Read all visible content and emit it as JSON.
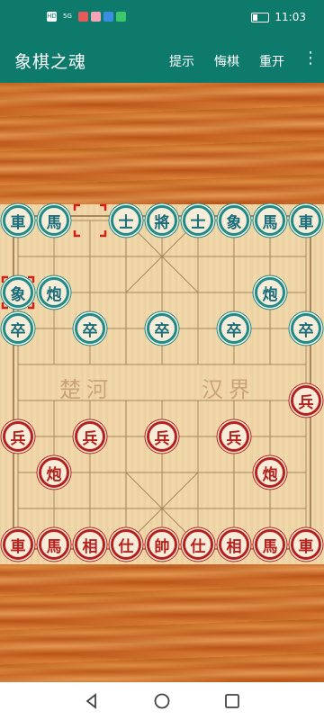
{
  "status_bar": {
    "time": "11:03",
    "left_icons": [
      "HD",
      "5G",
      "app-icon-red",
      "app-icon-pink",
      "app-icon-blue",
      "app-icon-green"
    ]
  },
  "app_bar": {
    "title": "象棋之魂",
    "hint": "提示",
    "undo": "悔棋",
    "restart": "重开",
    "menu_icon": "⋮"
  },
  "board": {
    "river_left": "楚河",
    "river_right": "汉界"
  },
  "pieces": [
    {
      "side": "black",
      "char": "車",
      "col": 0,
      "row": 0
    },
    {
      "side": "black",
      "char": "馬",
      "col": 1,
      "row": 0
    },
    {
      "side": "black",
      "char": "士",
      "col": 3,
      "row": 0
    },
    {
      "side": "black",
      "char": "將",
      "col": 4,
      "row": 0
    },
    {
      "side": "black",
      "char": "士",
      "col": 5,
      "row": 0
    },
    {
      "side": "black",
      "char": "象",
      "col": 6,
      "row": 0
    },
    {
      "side": "black",
      "char": "馬",
      "col": 7,
      "row": 0
    },
    {
      "side": "black",
      "char": "車",
      "col": 8,
      "row": 0
    },
    {
      "side": "black",
      "char": "象",
      "col": 0,
      "row": 2
    },
    {
      "side": "black",
      "char": "炮",
      "col": 1,
      "row": 2
    },
    {
      "side": "black",
      "char": "炮",
      "col": 7,
      "row": 2
    },
    {
      "side": "black",
      "char": "卒",
      "col": 0,
      "row": 3
    },
    {
      "side": "black",
      "char": "卒",
      "col": 2,
      "row": 3
    },
    {
      "side": "black",
      "char": "卒",
      "col": 4,
      "row": 3
    },
    {
      "side": "black",
      "char": "卒",
      "col": 6,
      "row": 3
    },
    {
      "side": "black",
      "char": "卒",
      "col": 8,
      "row": 3
    },
    {
      "side": "red",
      "char": "兵",
      "col": 8,
      "row": 5
    },
    {
      "side": "red",
      "char": "兵",
      "col": 0,
      "row": 6
    },
    {
      "side": "red",
      "char": "兵",
      "col": 2,
      "row": 6
    },
    {
      "side": "red",
      "char": "兵",
      "col": 4,
      "row": 6
    },
    {
      "side": "red",
      "char": "兵",
      "col": 6,
      "row": 6
    },
    {
      "side": "red",
      "char": "炮",
      "col": 1,
      "row": 7
    },
    {
      "side": "red",
      "char": "炮",
      "col": 7,
      "row": 7
    },
    {
      "side": "red",
      "char": "車",
      "col": 0,
      "row": 9
    },
    {
      "side": "red",
      "char": "馬",
      "col": 1,
      "row": 9
    },
    {
      "side": "red",
      "char": "相",
      "col": 2,
      "row": 9
    },
    {
      "side": "red",
      "char": "仕",
      "col": 3,
      "row": 9
    },
    {
      "side": "red",
      "char": "帥",
      "col": 4,
      "row": 9
    },
    {
      "side": "red",
      "char": "仕",
      "col": 5,
      "row": 9
    },
    {
      "side": "red",
      "char": "相",
      "col": 6,
      "row": 9
    },
    {
      "side": "red",
      "char": "馬",
      "col": 7,
      "row": 9
    },
    {
      "side": "red",
      "char": "車",
      "col": 8,
      "row": 9
    }
  ],
  "last_move": {
    "from": {
      "col": 2,
      "row": 0
    },
    "to": {
      "col": 0,
      "row": 2
    }
  },
  "colors": {
    "app_bar": "#0e7a6b",
    "black_piece": "#1f8a8a",
    "red_piece": "#b3221f",
    "board": "#f1d7a8"
  }
}
